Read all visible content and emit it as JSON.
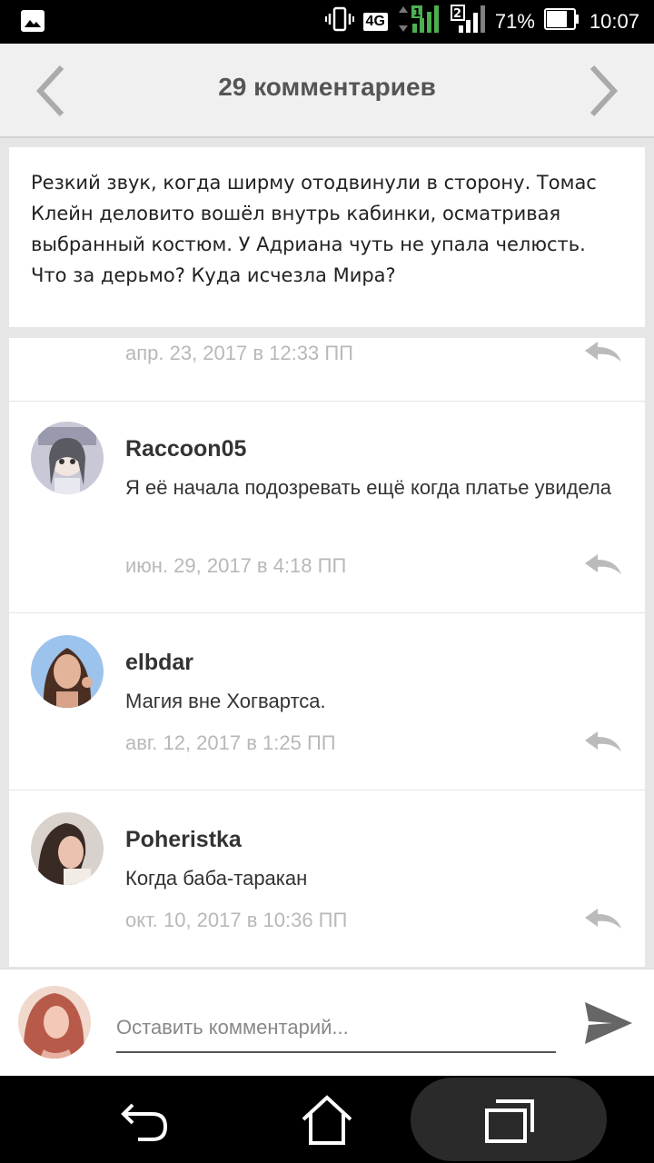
{
  "status_bar": {
    "network": "4G",
    "sim1": "1",
    "sim2": "2",
    "battery": "71%",
    "time": "10:07"
  },
  "header": {
    "title": "29 комментариев"
  },
  "excerpt": {
    "text": "Резкий звук, когда ширму отодвинули в сторону. Томас Клейн деловито вошёл внутрь кабинки, осматривая выбранный костюм. У Адриана чуть не упала челюсть. Что за дерьмо? Куда исчезла Мира?"
  },
  "comments": [
    {
      "author": "",
      "text": "",
      "date": "апр. 23, 2017 в 12:33 ПП"
    },
    {
      "author": "Raccoon05",
      "text": "Я её начала подозревать ещё когда платье увидела",
      "date": "июн. 29, 2017 в 4:18 ПП"
    },
    {
      "author": "elbdar",
      "text": "Магия вне Хогвартса.",
      "date": "авг. 12, 2017 в 1:25 ПП"
    },
    {
      "author": "Poheristka",
      "text": "Когда баба-таракан",
      "date": "окт. 10, 2017 в 10:36 ПП"
    }
  ],
  "composer": {
    "placeholder": "Оставить комментарий..."
  },
  "icons": {
    "prev": "chevron-left-icon",
    "next": "chevron-right-icon",
    "reply": "reply-icon",
    "send": "send-icon",
    "back": "back-icon",
    "home": "home-icon",
    "recents": "recents-icon"
  }
}
